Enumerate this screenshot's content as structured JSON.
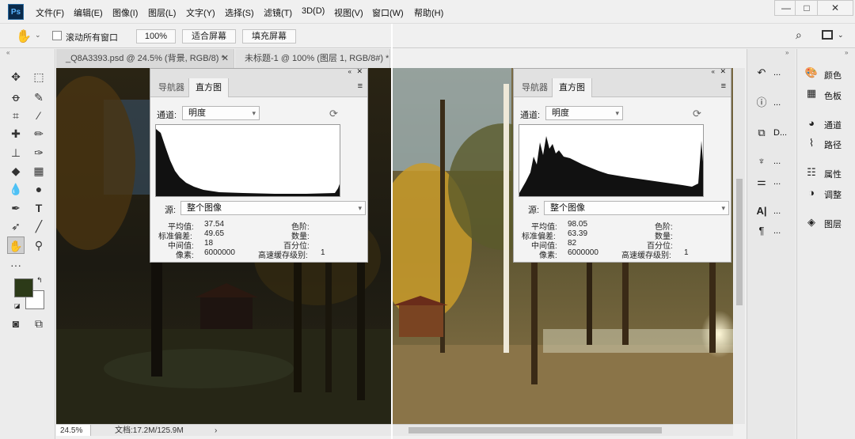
{
  "menubar": {
    "logo": "Ps",
    "items": [
      "文件(F)",
      "编辑(E)",
      "图像(I)",
      "图层(L)",
      "文字(Y)",
      "选择(S)",
      "滤镜(T)",
      "3D(D)",
      "视图(V)",
      "窗口(W)",
      "帮助(H)"
    ],
    "win": {
      "minimize": "—",
      "restore": "□",
      "close": "✕"
    }
  },
  "options": {
    "scroll_all": "滚动所有窗口",
    "zoom": "100%",
    "fit_screen": "适合屏幕",
    "fill_screen": "填充屏幕"
  },
  "tabs": {
    "doc1": "_Q8A3393.psd @ 24.5% (背景, RGB/8) *",
    "doc2": "未标题-1 @ 100% (图层 1, RGB/8#) *"
  },
  "histogram_left": {
    "tab_nav": "导航器",
    "tab_hist": "直方图",
    "channel_label": "通道:",
    "channel_value": "明度",
    "source_label": "源:",
    "source_value": "整个图像",
    "stats": {
      "mean_label": "平均值:",
      "mean": "37.54",
      "std_label": "标准偏差:",
      "std": "49.65",
      "median_label": "中间值:",
      "median": "18",
      "pixels_label": "像素:",
      "pixels": "6000000",
      "level_label": "色阶:",
      "count_label": "数量:",
      "percent_label": "百分位:",
      "cache_label": "高速缓存级别:",
      "cache": "1"
    }
  },
  "histogram_right": {
    "tab_nav": "导航器",
    "tab_hist": "直方图",
    "channel_label": "通道:",
    "channel_value": "明度",
    "source_label": "源:",
    "source_value": "整个图像",
    "stats": {
      "mean_label": "平均值:",
      "mean": "98.05",
      "std_label": "标准偏差:",
      "std": "63.39",
      "median_label": "中间值:",
      "median": "82",
      "pixels_label": "像素:",
      "pixels": "6000000",
      "level_label": "色阶:",
      "count_label": "数量:",
      "percent_label": "百分位:",
      "cache_label": "高速缓存级别:",
      "cache": "1"
    }
  },
  "right_panel": {
    "color": "颜色",
    "swatches": "色板",
    "channels": "通道",
    "paths": "路径",
    "properties": "属性",
    "adjustments": "调整",
    "layers": "图层",
    "dot": "...",
    "d_label": "D..."
  },
  "status": {
    "zoom": "24.5%",
    "doc": "文档:17.2M/125.9M",
    "arrow": "›"
  },
  "colors": {
    "foreground": "#2c3a18",
    "background": "#ffffff"
  }
}
